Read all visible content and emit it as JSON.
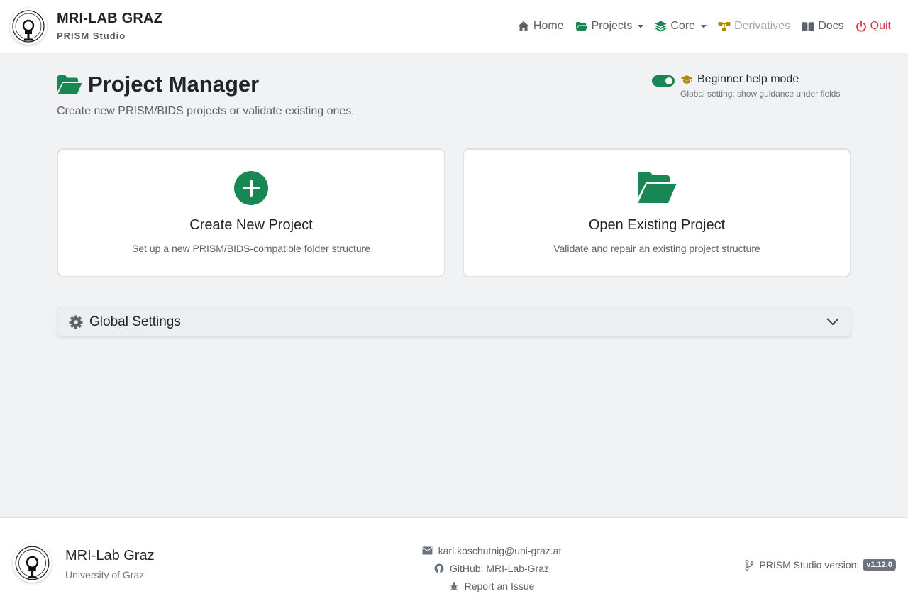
{
  "brand": {
    "title": "MRI-LAB GRAZ",
    "subtitle": "PRISM Studio",
    "logo_icon": "lab-logo-icon"
  },
  "nav": {
    "home": {
      "label": "Home",
      "icon": "home-icon"
    },
    "projects": {
      "label": "Projects",
      "icon": "folder-open-icon",
      "color": "#198754"
    },
    "core": {
      "label": "Core",
      "icon": "layers-icon",
      "color": "#198754"
    },
    "derivatives": {
      "label": "Derivatives",
      "icon": "sitemap-icon",
      "color": "#b08a00"
    },
    "docs": {
      "label": "Docs",
      "icon": "book-icon"
    },
    "quit": {
      "label": "Quit",
      "icon": "power-icon",
      "color": "#dc3545"
    }
  },
  "page": {
    "title": "Project Manager",
    "description": "Create new PRISM/BIDS projects or validate existing ones.",
    "help_mode": {
      "label": "Beginner help mode",
      "note": "Global setting: show guidance under fields",
      "enabled": true
    }
  },
  "cards": {
    "create": {
      "title": "Create New Project",
      "text": "Set up a new PRISM/BIDS-compatible folder structure",
      "icon": "plus-circle-icon"
    },
    "open": {
      "title": "Open Existing Project",
      "text": "Validate and repair an existing project structure",
      "icon": "folder-open-icon"
    }
  },
  "settings": {
    "title": "Global Settings",
    "icon": "gear-icon",
    "expanded": false
  },
  "footer": {
    "name": "MRI-Lab Graz",
    "university": "University of Graz",
    "email": "karl.koschutnig@uni-graz.at",
    "github": "GitHub: MRI-Lab-Graz",
    "issue": "Report an Issue",
    "version_label": "PRISM Studio version:",
    "version": "v1.12.0"
  },
  "colors": {
    "primary": "#198754",
    "accent": "#b08a00",
    "danger": "#dc3545",
    "muted": "#6c757d"
  }
}
